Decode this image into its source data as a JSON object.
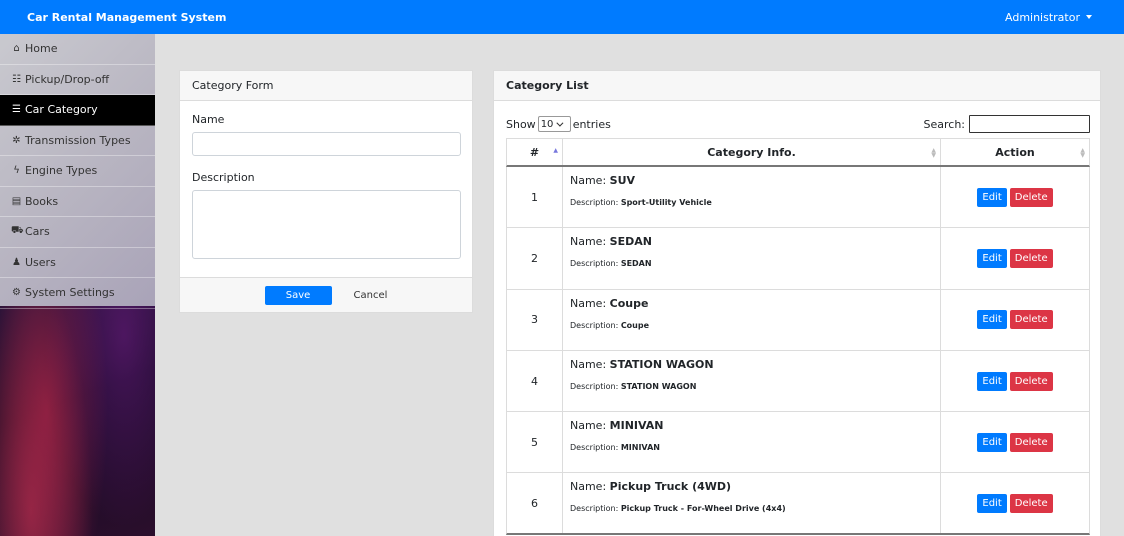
{
  "header": {
    "title": "Car Rental Management System",
    "user": "Administrator"
  },
  "sidebar": {
    "items": [
      {
        "label": "Home",
        "icon": "home-icon",
        "glyph": "⌂"
      },
      {
        "label": "Pickup/Drop-off",
        "icon": "list-icon",
        "glyph": "☷"
      },
      {
        "label": "Car Category",
        "icon": "list-icon",
        "glyph": "☰",
        "active": true
      },
      {
        "label": "Transmission Types",
        "icon": "gear-icon",
        "glyph": "✲"
      },
      {
        "label": "Engine Types",
        "icon": "bolt-icon",
        "glyph": "ϟ"
      },
      {
        "label": "Books",
        "icon": "book-icon",
        "glyph": "▤"
      },
      {
        "label": "Cars",
        "icon": "car-icon",
        "glyph": "⛟"
      },
      {
        "label": "Users",
        "icon": "users-icon",
        "glyph": "♟"
      },
      {
        "label": "System Settings",
        "icon": "cogs-icon",
        "glyph": "⚙"
      }
    ]
  },
  "form": {
    "title": "Category Form",
    "name_label": "Name",
    "name_value": "",
    "description_label": "Description",
    "description_value": "",
    "save_label": "Save",
    "cancel_label": "Cancel"
  },
  "list": {
    "title": "Category List",
    "show_label": "Show",
    "entries_value": "10",
    "entries_label": "entries",
    "search_label": "Search:",
    "search_value": "",
    "columns": [
      "#",
      "Category Info.",
      "Action"
    ],
    "name_prefix": "Name: ",
    "desc_prefix": "Description: ",
    "edit_label": "Edit",
    "delete_label": "Delete",
    "rows": [
      {
        "num": "1",
        "name": "SUV",
        "description": "Sport-Utility Vehicle"
      },
      {
        "num": "2",
        "name": "SEDAN",
        "description": "SEDAN"
      },
      {
        "num": "3",
        "name": "Coupe",
        "description": "Coupe"
      },
      {
        "num": "4",
        "name": "STATION WAGON",
        "description": "STATION WAGON"
      },
      {
        "num": "5",
        "name": "MINIVAN",
        "description": "MINIVAN"
      },
      {
        "num": "6",
        "name": "Pickup Truck (4WD)",
        "description": "Pickup Truck - For-Wheel Drive (4x4)"
      }
    ]
  },
  "colors": {
    "primary": "#007bff",
    "danger": "#dc3545",
    "active_nav": "#000000"
  }
}
